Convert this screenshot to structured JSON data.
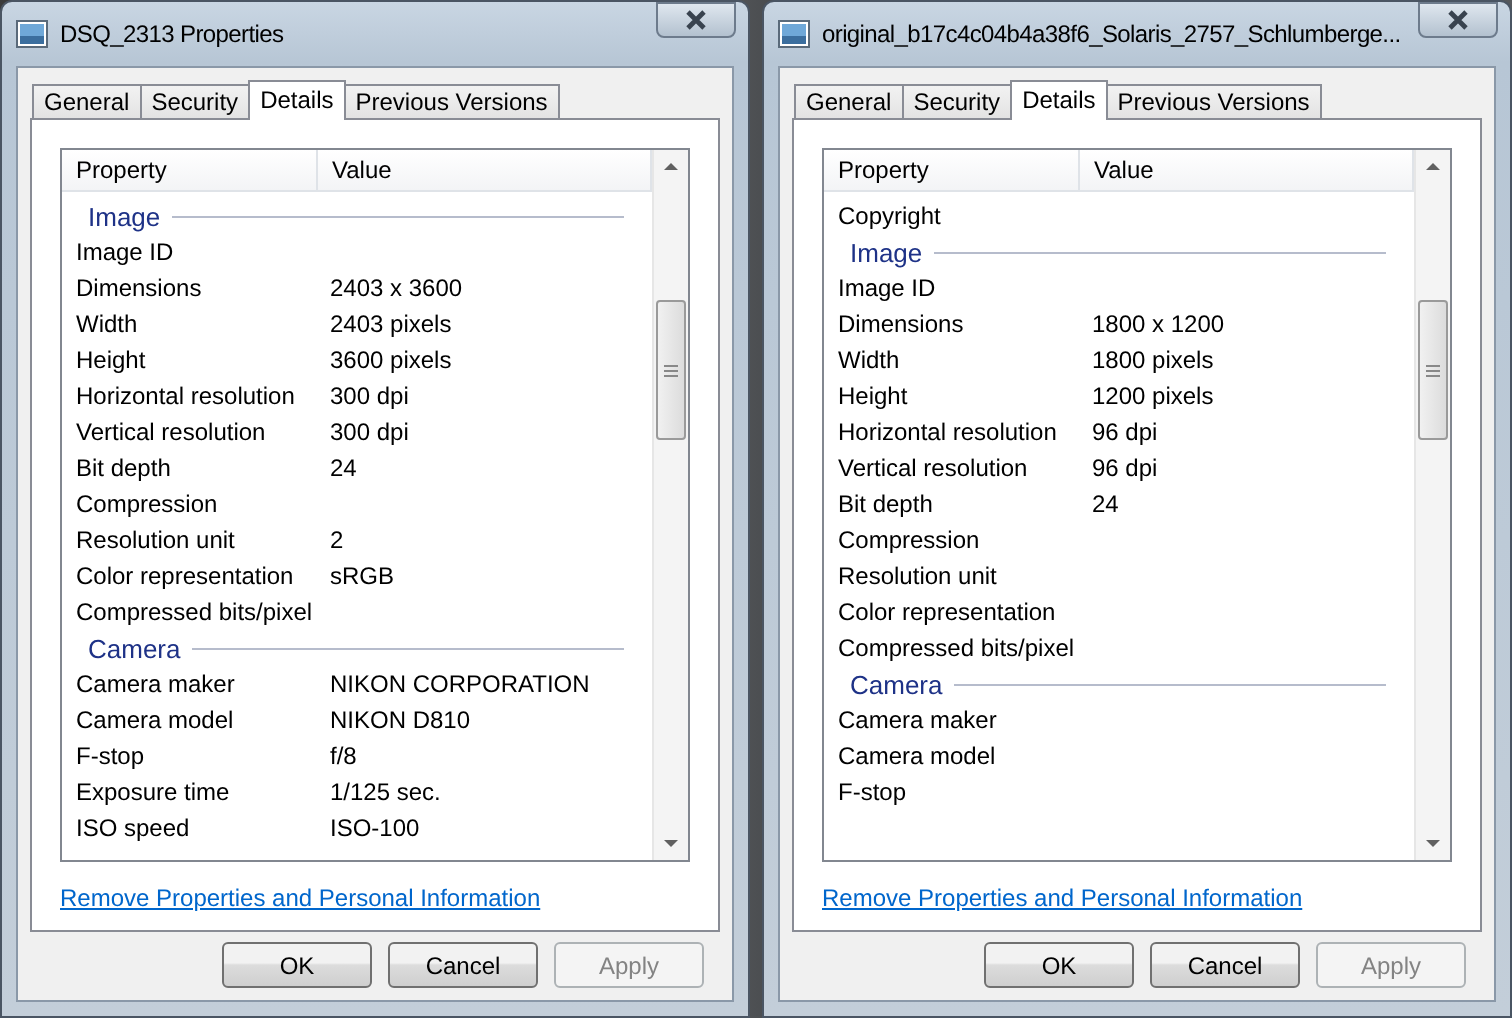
{
  "windows": [
    {
      "title": "DSQ_2313 Properties",
      "tabs": [
        {
          "label": "General",
          "selected": false
        },
        {
          "label": "Security",
          "selected": false
        },
        {
          "label": "Details",
          "selected": true
        },
        {
          "label": "Previous Versions",
          "selected": false
        }
      ],
      "columns": [
        "Property",
        "Value"
      ],
      "rows": [
        {
          "kind": "heading",
          "property": "Image"
        },
        {
          "kind": "prop",
          "property": "Image ID"
        },
        {
          "kind": "prop",
          "property": "Dimensions",
          "value": "2403 x 3600"
        },
        {
          "kind": "prop",
          "property": "Width",
          "value": "2403 pixels"
        },
        {
          "kind": "prop",
          "property": "Height",
          "value": "3600 pixels"
        },
        {
          "kind": "prop",
          "property": "Horizontal resolution",
          "value": "300 dpi"
        },
        {
          "kind": "prop",
          "property": "Vertical resolution",
          "value": "300 dpi"
        },
        {
          "kind": "prop",
          "property": "Bit depth",
          "value": "24"
        },
        {
          "kind": "prop",
          "property": "Compression"
        },
        {
          "kind": "prop",
          "property": "Resolution unit",
          "value": "2"
        },
        {
          "kind": "prop",
          "property": "Color representation",
          "value": "sRGB"
        },
        {
          "kind": "prop",
          "property": "Compressed bits/pixel"
        },
        {
          "kind": "heading",
          "property": "Camera"
        },
        {
          "kind": "prop",
          "property": "Camera maker",
          "value": "NIKON CORPORATION"
        },
        {
          "kind": "prop",
          "property": "Camera model",
          "value": "NIKON D810"
        },
        {
          "kind": "prop",
          "property": "F-stop",
          "value": "f/8"
        },
        {
          "kind": "prop",
          "property": "Exposure time",
          "value": "1/125 sec."
        },
        {
          "kind": "prop",
          "property": "ISO speed",
          "value": "ISO-100"
        }
      ],
      "link": "Remove Properties and Personal Information",
      "buttons": [
        {
          "label": "OK",
          "disabled": false
        },
        {
          "label": "Cancel",
          "disabled": false
        },
        {
          "label": "Apply",
          "disabled": true
        }
      ]
    },
    {
      "title": "original_b17c4c04b4a38f6_Solaris_2757_Schlumberge...",
      "tabs": [
        {
          "label": "General",
          "selected": false
        },
        {
          "label": "Security",
          "selected": false
        },
        {
          "label": "Details",
          "selected": true
        },
        {
          "label": "Previous Versions",
          "selected": false
        }
      ],
      "columns": [
        "Property",
        "Value"
      ],
      "rows": [
        {
          "kind": "prop",
          "property": "Copyright"
        },
        {
          "kind": "heading",
          "property": "Image"
        },
        {
          "kind": "prop",
          "property": "Image ID"
        },
        {
          "kind": "prop",
          "property": "Dimensions",
          "value": "1800 x 1200"
        },
        {
          "kind": "prop",
          "property": "Width",
          "value": "1800 pixels"
        },
        {
          "kind": "prop",
          "property": "Height",
          "value": "1200 pixels"
        },
        {
          "kind": "prop",
          "property": "Horizontal resolution",
          "value": "96 dpi"
        },
        {
          "kind": "prop",
          "property": "Vertical resolution",
          "value": "96 dpi"
        },
        {
          "kind": "prop",
          "property": "Bit depth",
          "value": "24"
        },
        {
          "kind": "prop",
          "property": "Compression"
        },
        {
          "kind": "prop",
          "property": "Resolution unit"
        },
        {
          "kind": "prop",
          "property": "Color representation"
        },
        {
          "kind": "prop",
          "property": "Compressed bits/pixel"
        },
        {
          "kind": "heading",
          "property": "Camera"
        },
        {
          "kind": "prop",
          "property": "Camera maker"
        },
        {
          "kind": "prop",
          "property": "Camera model"
        },
        {
          "kind": "prop",
          "property": "F-stop"
        }
      ],
      "link": "Remove Properties and Personal Information",
      "buttons": [
        {
          "label": "OK",
          "disabled": false
        },
        {
          "label": "Cancel",
          "disabled": false
        },
        {
          "label": "Apply",
          "disabled": true
        }
      ]
    }
  ]
}
